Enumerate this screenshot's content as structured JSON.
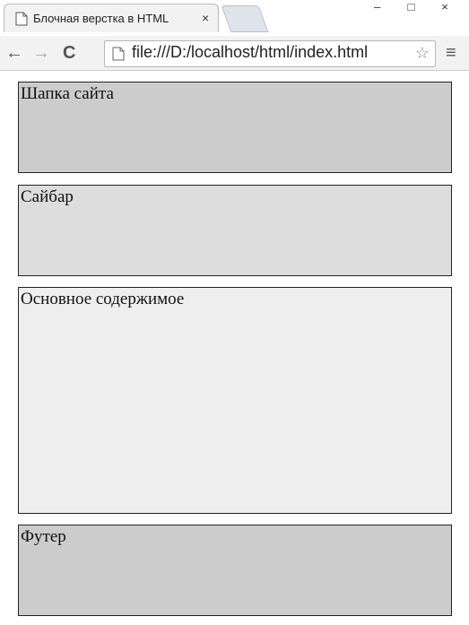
{
  "browser": {
    "tab_title": "Блочная верстка в HTML",
    "tab_close": "×",
    "url": "file:///D:/localhost/html/index.html",
    "window_controls": [
      "–",
      "□",
      "×"
    ],
    "nav": {
      "back": "←",
      "forward": "→",
      "reload": "C"
    },
    "star": "☆",
    "menu": "≡"
  },
  "page": {
    "header_text": "Шапка сайта",
    "sidebar_text": "Сайбар",
    "main_text": "Основное содержимое",
    "footer_text": "Футер"
  },
  "colors": {
    "header_bg": "#cccccc",
    "sidebar_bg": "#dddddd",
    "main_bg": "#eeeeee",
    "footer_bg": "#cccccc"
  }
}
